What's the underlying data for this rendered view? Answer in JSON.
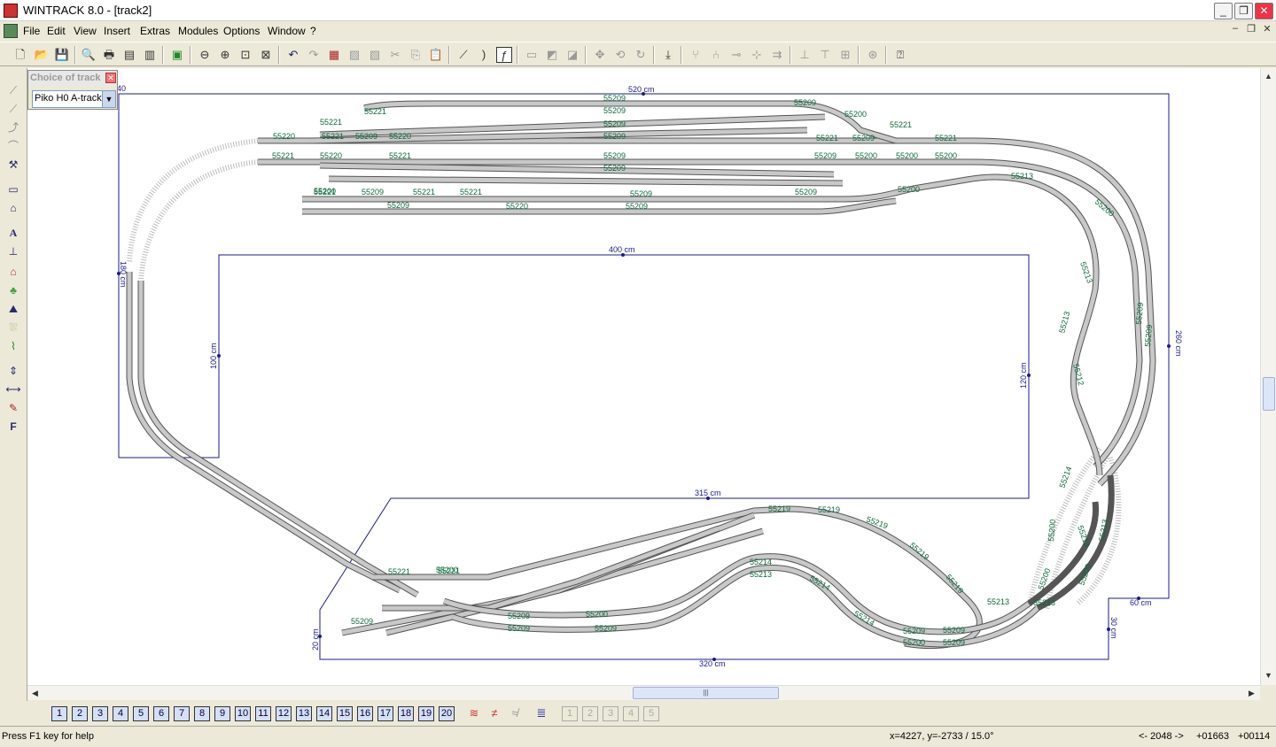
{
  "window": {
    "title": "WINTRACK 8.0 - [track2]",
    "min": "_",
    "max": "❐",
    "close": "✕"
  },
  "menu": [
    "File",
    "Edit",
    "View",
    "Insert",
    "Extras",
    "Modules",
    "Options",
    "Window",
    "?"
  ],
  "toolbar_icons": [
    "new",
    "open",
    "save",
    "print-preview",
    "print",
    "print-setup",
    "list",
    "picture",
    "zoom-out",
    "zoom-in",
    "zoom-window",
    "zoom-all",
    "undo",
    "redo",
    "catalog",
    "copy-track",
    "paste-track",
    "cut",
    "copy",
    "paste",
    "flex-track",
    "curve",
    "line",
    "text",
    "layer-a",
    "layer-b",
    "layer-c",
    "move",
    "rotate",
    "rotate-180",
    "insert-point",
    "split",
    "join",
    "connect",
    "level",
    "height",
    "height-2",
    "height-3",
    "grid",
    "help"
  ],
  "choice_panel": {
    "title": "Choice of track",
    "selected": "Piko H0 A-track"
  },
  "dimensions": {
    "top": "520 cm",
    "inner_top": "400 cm",
    "right": "260 cm",
    "inner_left": "100 cm",
    "inner_right": "120 cm",
    "inner_bottom": "315 cm",
    "bottom": "320 cm",
    "bottom_right": "60 cm",
    "left": "180 cm",
    "left_small": "20 cm",
    "right_small": "30 cm",
    "corner_left": "40"
  },
  "track_labels": [
    "55209",
    "55209",
    "55209",
    "55209",
    "55209",
    "55209",
    "55209",
    "55209",
    "55221",
    "55221",
    "55220",
    "55221",
    "55209",
    "55220",
    "55221",
    "55220",
    "55221",
    "55221",
    "55209",
    "55209",
    "55221",
    "55220",
    "55221",
    "55200",
    "55209",
    "55200",
    "55221",
    "55221",
    "55209",
    "55221",
    "55209",
    "55213",
    "55209",
    "55200",
    "55200",
    "55200",
    "55200",
    "55213",
    "55212",
    "55221",
    "55213",
    "55200",
    "55209",
    "55221",
    "55209",
    "55219",
    "55219",
    "55219",
    "55219",
    "55219",
    "55214",
    "55213",
    "55214",
    "55214",
    "55213",
    "55209",
    "55209",
    "55209",
    "55200",
    "55213",
    "55213",
    "55214",
    "55213",
    "55200",
    "55200",
    "55200",
    "55200",
    "55200",
    "55209",
    "55209",
    "55209",
    "55209"
  ],
  "layers": [
    "1",
    "2",
    "3",
    "4",
    "5",
    "6",
    "7",
    "8",
    "9",
    "10",
    "11",
    "12",
    "13",
    "14",
    "15",
    "16",
    "17",
    "18",
    "19",
    "20"
  ],
  "layers_disabled": [
    "1",
    "2",
    "3",
    "4",
    "5"
  ],
  "status": {
    "help": "Press F1 key for help",
    "coords": "x=4227, y=-2733 / 15.0°",
    "nav": "<- 2048 ->",
    "val1": "+01663",
    "val2": "+00114"
  }
}
